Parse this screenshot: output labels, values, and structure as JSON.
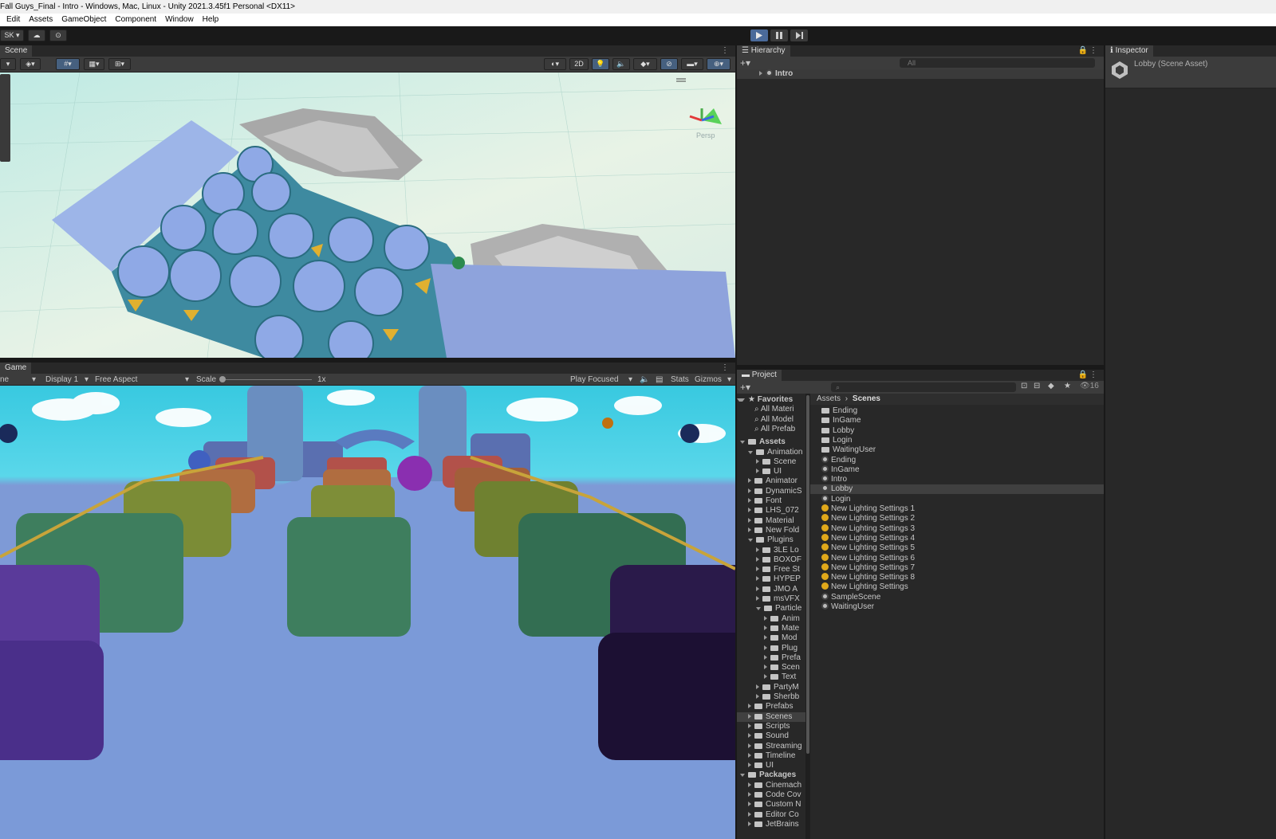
{
  "window": {
    "title": "Fall Guys_Final - Intro - Windows, Mac, Linux - Unity 2021.3.45f1 Personal <DX11>"
  },
  "menu": [
    "Edit",
    "Assets",
    "GameObject",
    "Component",
    "Window",
    "Help"
  ],
  "toolbar": {
    "account": "SK"
  },
  "scene": {
    "tab": "Scene",
    "btn_2d": "2D",
    "persp": "Persp"
  },
  "game": {
    "tab": "Game",
    "display": "Display 1",
    "aspect": "Free Aspect",
    "scale_label": "Scale",
    "scale_value": "1x",
    "play_mode": "Play Focused",
    "stats": "Stats",
    "gizmos": "Gizmos"
  },
  "hierarchy": {
    "tab": "Hierarchy",
    "search_placeholder": "All",
    "root": "Intro"
  },
  "inspector": {
    "tab": "Inspector",
    "title": "Lobby (Scene Asset)"
  },
  "project": {
    "tab": "Project",
    "count": "16",
    "breadcrumb": [
      "Assets",
      "Scenes"
    ],
    "favorites_label": "Favorites",
    "favorites": [
      "All Materi",
      "All Model",
      "All Prefab"
    ],
    "tree": [
      {
        "label": "Assets",
        "depth": 0,
        "bold": true
      },
      {
        "label": "Animation",
        "depth": 1
      },
      {
        "label": "Scene",
        "depth": 2
      },
      {
        "label": "UI",
        "depth": 2
      },
      {
        "label": "Animator",
        "depth": 1
      },
      {
        "label": "DynamicS",
        "depth": 1
      },
      {
        "label": "Font",
        "depth": 1
      },
      {
        "label": "LHS_072",
        "depth": 1
      },
      {
        "label": "Material",
        "depth": 1
      },
      {
        "label": "New Fold",
        "depth": 1
      },
      {
        "label": "Plugins",
        "depth": 1
      },
      {
        "label": "3LE Lo",
        "depth": 2
      },
      {
        "label": "BOXOF",
        "depth": 2
      },
      {
        "label": "Free St",
        "depth": 2
      },
      {
        "label": "HYPEP",
        "depth": 2
      },
      {
        "label": "JMO A",
        "depth": 2
      },
      {
        "label": "msVFX",
        "depth": 2
      },
      {
        "label": "Particle",
        "depth": 2
      },
      {
        "label": "Anim",
        "depth": 3
      },
      {
        "label": "Mate",
        "depth": 3
      },
      {
        "label": "Mod",
        "depth": 3
      },
      {
        "label": "Plug",
        "depth": 3
      },
      {
        "label": "Prefa",
        "depth": 3
      },
      {
        "label": "Scen",
        "depth": 3
      },
      {
        "label": "Text",
        "depth": 3
      },
      {
        "label": "PartyM",
        "depth": 2
      },
      {
        "label": "Sherbb",
        "depth": 2
      },
      {
        "label": "Prefabs",
        "depth": 1
      },
      {
        "label": "Scenes",
        "depth": 1,
        "selected": true
      },
      {
        "label": "Scripts",
        "depth": 1
      },
      {
        "label": "Sound",
        "depth": 1
      },
      {
        "label": "Streaming",
        "depth": 1
      },
      {
        "label": "Timeline",
        "depth": 1
      },
      {
        "label": "UI",
        "depth": 1
      },
      {
        "label": "Packages",
        "depth": 0,
        "bold": true
      },
      {
        "label": "Cinemach",
        "depth": 1
      },
      {
        "label": "Code Cov",
        "depth": 1
      },
      {
        "label": "Custom N",
        "depth": 1
      },
      {
        "label": "Editor Co",
        "depth": 1
      },
      {
        "label": "JetBrains",
        "depth": 1
      }
    ],
    "files": [
      {
        "label": "Ending",
        "icon": "folder"
      },
      {
        "label": "InGame",
        "icon": "folder"
      },
      {
        "label": "Lobby",
        "icon": "folder"
      },
      {
        "label": "Login",
        "icon": "folder"
      },
      {
        "label": "WaitingUser",
        "icon": "folder"
      },
      {
        "label": "Ending",
        "icon": "scene"
      },
      {
        "label": "InGame",
        "icon": "scene"
      },
      {
        "label": "Intro",
        "icon": "scene"
      },
      {
        "label": "Lobby",
        "icon": "scene",
        "selected": true
      },
      {
        "label": "Login",
        "icon": "scene"
      },
      {
        "label": "New Lighting Settings 1",
        "icon": "light"
      },
      {
        "label": "New Lighting Settings 2",
        "icon": "light"
      },
      {
        "label": "New Lighting Settings 3",
        "icon": "light"
      },
      {
        "label": "New Lighting Settings 4",
        "icon": "light"
      },
      {
        "label": "New Lighting Settings 5",
        "icon": "light"
      },
      {
        "label": "New Lighting Settings 6",
        "icon": "light"
      },
      {
        "label": "New Lighting Settings 7",
        "icon": "light"
      },
      {
        "label": "New Lighting Settings 8",
        "icon": "light"
      },
      {
        "label": "New Lighting Settings",
        "icon": "light"
      },
      {
        "label": "SampleScene",
        "icon": "scene"
      },
      {
        "label": "WaitingUser",
        "icon": "scene"
      }
    ]
  }
}
